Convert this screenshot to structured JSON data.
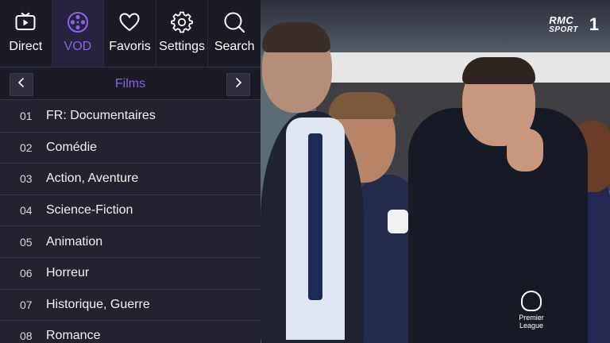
{
  "nav": {
    "items": [
      {
        "label": "Direct",
        "icon": "tv-icon",
        "active": false
      },
      {
        "label": "VOD",
        "icon": "film-reel-icon",
        "active": true
      },
      {
        "label": "Favoris",
        "icon": "heart-icon",
        "active": false
      },
      {
        "label": "Settings",
        "icon": "gear-icon",
        "active": false
      },
      {
        "label": "Search",
        "icon": "search-icon",
        "active": false
      }
    ]
  },
  "category_bar": {
    "title": "Films",
    "prev_icon": "chevron-left-icon",
    "next_icon": "chevron-right-icon"
  },
  "categories": [
    {
      "num": "01",
      "name": "FR: Documentaires"
    },
    {
      "num": "02",
      "name": "Comédie"
    },
    {
      "num": "03",
      "name": "Action, Aventure"
    },
    {
      "num": "04",
      "name": "Science-Fiction"
    },
    {
      "num": "05",
      "name": "Animation"
    },
    {
      "num": "06",
      "name": "Horreur"
    },
    {
      "num": "07",
      "name": "Historique, Guerre"
    },
    {
      "num": "08",
      "name": "Romance"
    }
  ],
  "video": {
    "channel_logo_line1": "RMC",
    "channel_logo_line2": "SPORT",
    "channel_number": "1",
    "league_logo_text": "Premier League"
  },
  "colors": {
    "accent": "#8b63e6",
    "panel_bg": "#232330",
    "nav_bg": "#1b1b25"
  }
}
